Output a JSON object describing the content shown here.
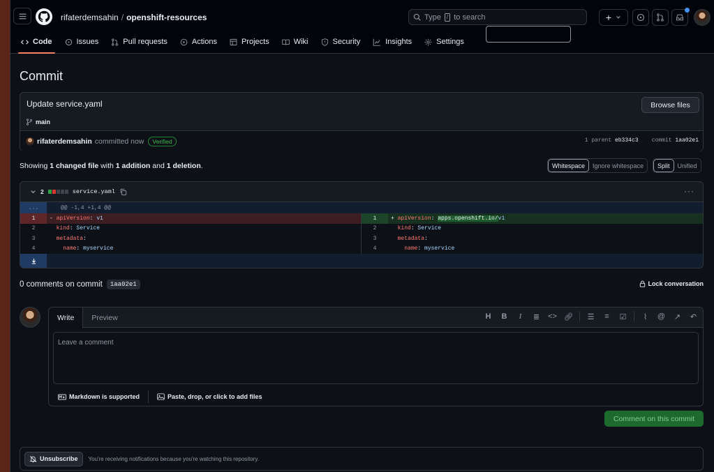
{
  "header": {
    "owner": "rifaterdemsahin",
    "separator": "/",
    "repo": "openshift-resources",
    "search_prefix": "Type",
    "search_key": "/",
    "search_suffix": "to search",
    "plus_label": "+"
  },
  "nav": [
    {
      "label": "Code",
      "icon": "code-icon"
    },
    {
      "label": "Issues",
      "icon": "issue-icon"
    },
    {
      "label": "Pull requests",
      "icon": "pull-request-icon"
    },
    {
      "label": "Actions",
      "icon": "play-icon"
    },
    {
      "label": "Projects",
      "icon": "table-icon"
    },
    {
      "label": "Wiki",
      "icon": "book-icon"
    },
    {
      "label": "Security",
      "icon": "shield-icon"
    },
    {
      "label": "Insights",
      "icon": "graph-icon"
    },
    {
      "label": "Settings",
      "icon": "gear-icon"
    }
  ],
  "page_title": "Commit",
  "commit": {
    "message": "Update service.yaml",
    "branch": "main",
    "browse_label": "Browse files",
    "author": "rifaterdemsahin",
    "committed": "committed now",
    "verified": "Verified",
    "parent_label": "1 parent",
    "parent_sha": "eb334c3",
    "commit_label": "commit",
    "commit_sha": "1aa02e1"
  },
  "summary": {
    "showing": "Showing",
    "changed": "1 changed file",
    "with": "with",
    "additions": "1 addition",
    "and": "and",
    "deletions": "1 deletion",
    "period": ".",
    "whitespace": "Whitespace",
    "ignore_whitespace": "Ignore whitespace",
    "split": "Split",
    "unified": "Unified"
  },
  "diff": {
    "count": "2",
    "filename": "service.yaml",
    "hunk": "@@ -1,4 +1,4 @@",
    "expand": "...",
    "left": [
      {
        "n": "1",
        "sign": "-",
        "key": "apiVersion",
        "colon": ": ",
        "val": "v1",
        "type": "del"
      },
      {
        "n": "2",
        "sign": " ",
        "key": "kind",
        "colon": ": ",
        "val": "Service",
        "type": "ctx"
      },
      {
        "n": "3",
        "sign": " ",
        "key": "metadata",
        "colon": ":",
        "val": "",
        "type": "ctx"
      },
      {
        "n": "4",
        "sign": " ",
        "key": "  name",
        "colon": ": ",
        "val": "myservice",
        "type": "ctx"
      }
    ],
    "right": [
      {
        "n": "1",
        "sign": "+",
        "key": "apiVersion",
        "colon": ": ",
        "hl": "apps.openshift.io/",
        "val": "v1",
        "type": "add"
      },
      {
        "n": "2",
        "sign": " ",
        "key": "kind",
        "colon": ": ",
        "hl": "",
        "val": "Service",
        "type": "ctx"
      },
      {
        "n": "3",
        "sign": " ",
        "key": "metadata",
        "colon": ":",
        "hl": "",
        "val": "",
        "type": "ctx"
      },
      {
        "n": "4",
        "sign": " ",
        "key": "  name",
        "colon": ": ",
        "hl": "",
        "val": "myservice",
        "type": "ctx"
      }
    ]
  },
  "comments": {
    "title": "0 comments on commit",
    "sha": "1aa02e1",
    "lock": "Lock conversation",
    "write_tab": "Write",
    "preview_tab": "Preview",
    "placeholder": "Leave a comment",
    "markdown": "Markdown is supported",
    "attach": "Paste, drop, or click to add files",
    "submit": "Comment on this commit"
  },
  "notifications": {
    "unsubscribe": "Unsubscribe",
    "reason": "You're receiving notifications because you're watching this repository."
  },
  "colors": {
    "accent": "#f78166",
    "add": "#2ea043",
    "del": "#da3633",
    "button_green": "#1c6b2d"
  }
}
